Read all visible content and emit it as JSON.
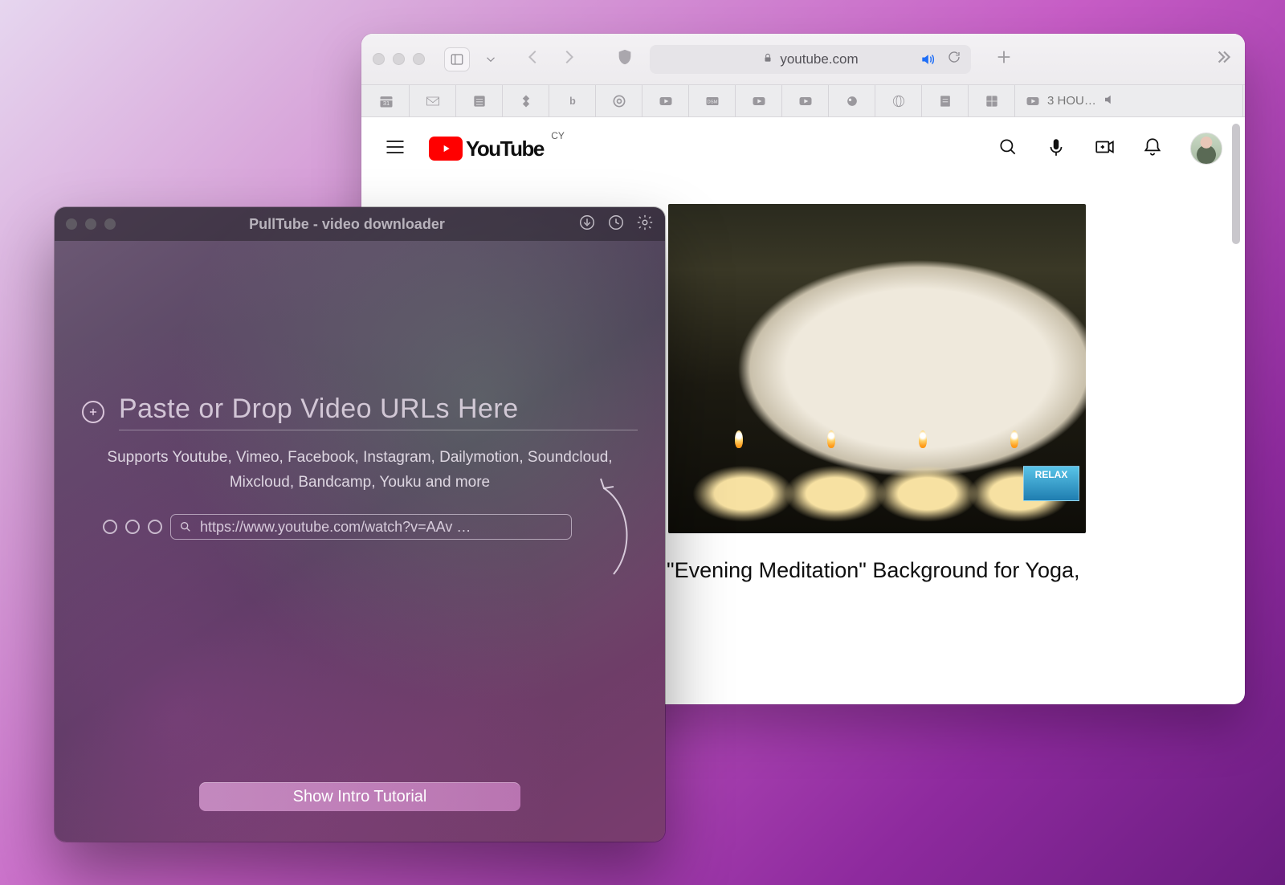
{
  "safari": {
    "address": "youtube.com",
    "favbar_label": "3 HOU…"
  },
  "youtube": {
    "brand": "YouTube",
    "country": "CY",
    "video_title": "\"Evening Meditation\" Background for Yoga,",
    "thumb_badge": "RELAX"
  },
  "pulltube": {
    "title": "PullTube - video downloader",
    "placeholder": "Paste or Drop Video URLs Here",
    "supports": "Supports Youtube, Vimeo, Facebook, Instagram, Dailymotion, Soundcloud, Mixcloud, Bandcamp, Youku and more",
    "mini_url": "https://www.youtube.com/watch?v=AAv …",
    "tutorial_button": "Show Intro Tutorial"
  }
}
